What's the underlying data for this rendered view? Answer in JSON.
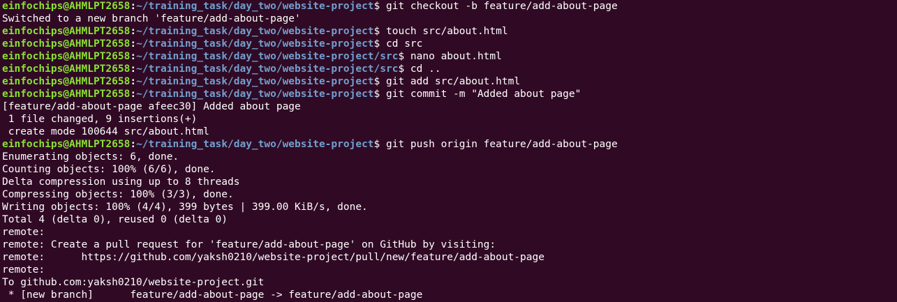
{
  "terminal": {
    "theme": {
      "background": "#300a24",
      "user_color": "#8ae234",
      "path_color": "#729fcf",
      "text_color": "#ffffff"
    },
    "lines": [
      {
        "type": "prompt",
        "user": "einfochips@AHMLPT2658",
        "path": "~/training_task/day_two/website-project",
        "cmd": "git checkout -b feature/add-about-page"
      },
      {
        "type": "output",
        "text": "Switched to a new branch 'feature/add-about-page'"
      },
      {
        "type": "prompt",
        "user": "einfochips@AHMLPT2658",
        "path": "~/training_task/day_two/website-project",
        "cmd": "touch src/about.html"
      },
      {
        "type": "prompt",
        "user": "einfochips@AHMLPT2658",
        "path": "~/training_task/day_two/website-project",
        "cmd": "cd src"
      },
      {
        "type": "prompt",
        "user": "einfochips@AHMLPT2658",
        "path": "~/training_task/day_two/website-project/src",
        "cmd": "nano about.html"
      },
      {
        "type": "prompt",
        "user": "einfochips@AHMLPT2658",
        "path": "~/training_task/day_two/website-project/src",
        "cmd": "cd .."
      },
      {
        "type": "prompt",
        "user": "einfochips@AHMLPT2658",
        "path": "~/training_task/day_two/website-project",
        "cmd": "git add src/about.html"
      },
      {
        "type": "prompt",
        "user": "einfochips@AHMLPT2658",
        "path": "~/training_task/day_two/website-project",
        "cmd": "git commit -m \"Added about page\""
      },
      {
        "type": "output",
        "text": "[feature/add-about-page afeec30] Added about page"
      },
      {
        "type": "output",
        "text": " 1 file changed, 9 insertions(+)"
      },
      {
        "type": "output",
        "text": " create mode 100644 src/about.html"
      },
      {
        "type": "prompt",
        "user": "einfochips@AHMLPT2658",
        "path": "~/training_task/day_two/website-project",
        "cmd": "git push origin feature/add-about-page"
      },
      {
        "type": "output",
        "text": "Enumerating objects: 6, done."
      },
      {
        "type": "output",
        "text": "Counting objects: 100% (6/6), done."
      },
      {
        "type": "output",
        "text": "Delta compression using up to 8 threads"
      },
      {
        "type": "output",
        "text": "Compressing objects: 100% (3/3), done."
      },
      {
        "type": "output",
        "text": "Writing objects: 100% (4/4), 399 bytes | 399.00 KiB/s, done."
      },
      {
        "type": "output",
        "text": "Total 4 (delta 0), reused 0 (delta 0)"
      },
      {
        "type": "output",
        "text": "remote:"
      },
      {
        "type": "output",
        "text": "remote: Create a pull request for 'feature/add-about-page' on GitHub by visiting:"
      },
      {
        "type": "output",
        "text": "remote:      https://github.com/yaksh0210/website-project/pull/new/feature/add-about-page"
      },
      {
        "type": "output",
        "text": "remote:"
      },
      {
        "type": "output",
        "text": "To github.com:yaksh0210/website-project.git"
      },
      {
        "type": "output",
        "text": " * [new branch]      feature/add-about-page -> feature/add-about-page"
      }
    ]
  }
}
